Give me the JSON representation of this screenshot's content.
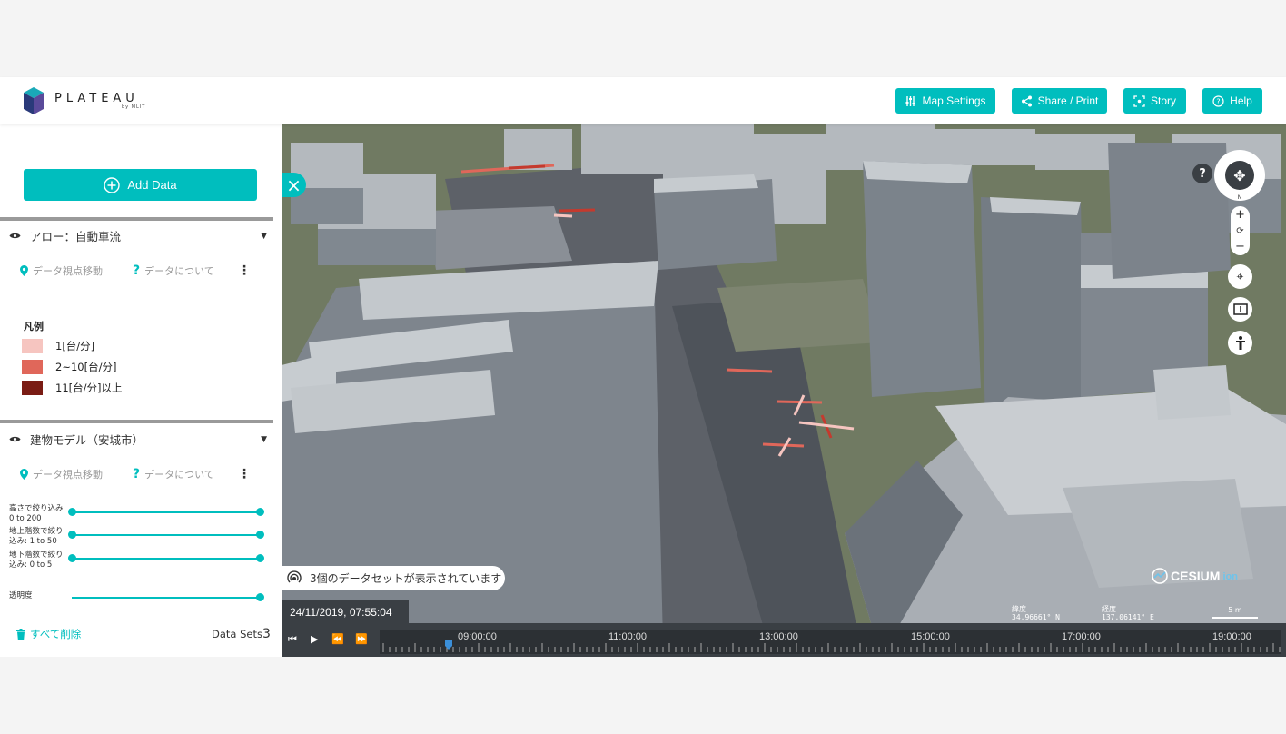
{
  "header": {
    "logo_word": "PLATEAU",
    "logo_sub": "by MLIT",
    "buttons": {
      "map_settings": "Map Settings",
      "share_print": "Share / Print",
      "story": "Story",
      "help": "Help"
    }
  },
  "sidebar": {
    "add_data": "Add Data",
    "layers": [
      {
        "title": "アロー：自動車流",
        "move_view": "データ視点移動",
        "about": "データについて",
        "legend": {
          "title": "凡例",
          "items": [
            {
              "label": "1[台/分]",
              "color": "#f6c5c0"
            },
            {
              "label": "2~10[台/分]",
              "color": "#e0675a"
            },
            {
              "label": "11[台/分]以上",
              "color": "#7a1c14"
            }
          ]
        }
      },
      {
        "title": "建物モデル（安城市）",
        "move_view": "データ視点移動",
        "about": "データについて",
        "filters": [
          {
            "label1": "高さで絞り込み",
            "label2": "0 to 200"
          },
          {
            "label1": "地上階数で絞り",
            "label2": "込み: 1 to 50"
          },
          {
            "label1": "地下階数で絞り",
            "label2": "込み: 0 to 5"
          }
        ],
        "opacity_label": "透明度"
      }
    ],
    "delete_all": "すべて削除",
    "datasets_label": "Data Sets",
    "datasets_count": "3"
  },
  "map": {
    "status": "3個のデータセットが表示されています",
    "datetime": "24/11/2019, 07:55:04",
    "attribution": "CESIUM",
    "attribution_suffix": "ion",
    "lat_label": "緯度",
    "lat_value": "34.96661° N",
    "lon_label": "経度",
    "lon_value": "137.06141° E",
    "scale": "5 m",
    "help_glyph": "?",
    "compass_north": "N",
    "timeline_labels": [
      "09:00:00",
      "11:00:00",
      "13:00:00",
      "15:00:00",
      "17:00:00",
      "19:00:00"
    ]
  },
  "colors": {
    "accent": "#00bebe",
    "panel_dark": "#3a3f44"
  }
}
